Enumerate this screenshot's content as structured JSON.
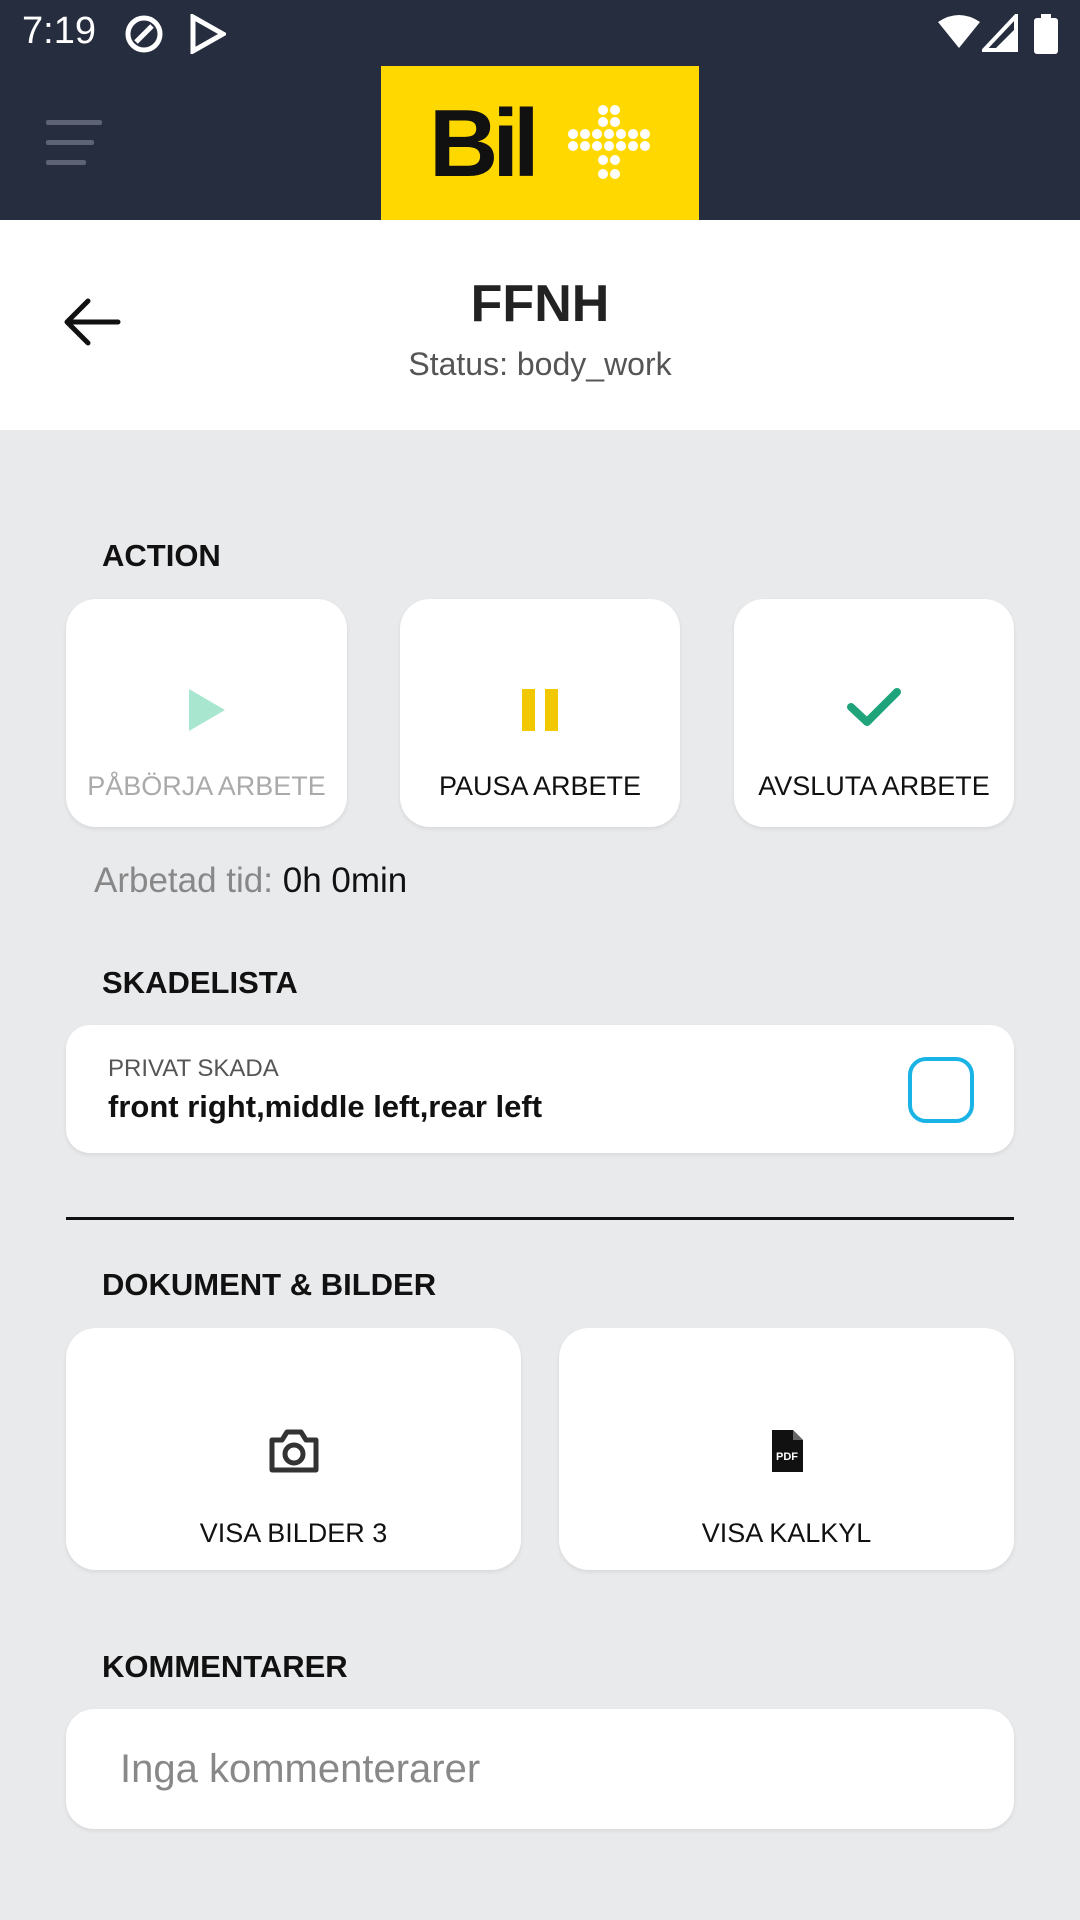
{
  "status_bar": {
    "time": "7:19"
  },
  "app": {
    "logo_text": "Bil"
  },
  "header": {
    "title": "FFNH",
    "status": "Status: body_work"
  },
  "action": {
    "section_title": "ACTION",
    "buttons": [
      {
        "label": "PÅBÖRJA ARBETE",
        "icon": "play-icon",
        "enabled": false
      },
      {
        "label": "PAUSA ARBETE",
        "icon": "pause-icon",
        "enabled": true
      },
      {
        "label": "AVSLUTA ARBETE",
        "icon": "check-icon",
        "enabled": true
      }
    ],
    "worked_label": "Arbetad tid:",
    "worked_value": "0h 0min"
  },
  "damage": {
    "section_title": "SKADELISTA",
    "items": [
      {
        "type": "PRIVAT SKADA",
        "text": "front right,middle left,rear left",
        "checked": false
      }
    ]
  },
  "documents": {
    "section_title": "DOKUMENT & BILDER",
    "buttons": [
      {
        "label": "VISA BILDER 3",
        "icon": "camera-icon"
      },
      {
        "label": "VISA KALKYL",
        "icon": "pdf-icon"
      }
    ]
  },
  "comments": {
    "section_title": "KOMMENTARER",
    "placeholder": "Inga kommenterarer"
  },
  "colors": {
    "navy": "#262d3f",
    "brand_yellow": "#ffd800",
    "play_disabled": "#a8e6cf",
    "pause": "#f2c800",
    "check": "#1fa37a",
    "checkbox": "#1ab3e6"
  }
}
